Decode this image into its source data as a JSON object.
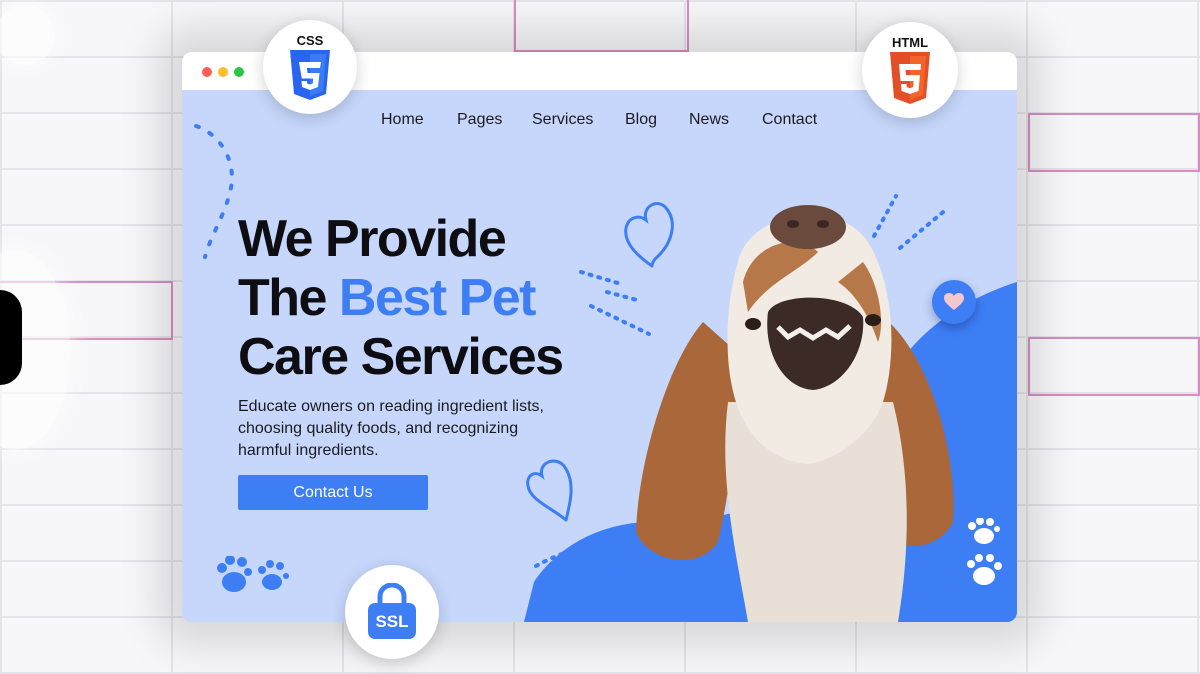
{
  "window": {
    "dots": [
      "#ff5f57",
      "#febc2e",
      "#28c840"
    ]
  },
  "nav": {
    "items": [
      {
        "id": "home",
        "label": "Home"
      },
      {
        "id": "pages",
        "label": "Pages"
      },
      {
        "id": "services",
        "label": "Services"
      },
      {
        "id": "blog",
        "label": "Blog"
      },
      {
        "id": "news",
        "label": "News"
      },
      {
        "id": "contact",
        "label": "Contact"
      }
    ]
  },
  "hero": {
    "line1": "We Provide",
    "line2_prefix": "The ",
    "line2_accent": "Best Pet",
    "line3": "Care Services",
    "description": "Educate owners on reading ingredient lists, choosing quality foods, and recognizing harmful ingredients.",
    "cta_label": "Contact Us"
  },
  "badges": {
    "css": {
      "label": "CSS",
      "icon": "css3-shield-icon",
      "color": "#2965f1"
    },
    "html": {
      "label": "HTML",
      "icon": "html5-shield-icon",
      "color": "#e34f26"
    },
    "ssl": {
      "label": "SSL",
      "icon": "ssl-lock-icon",
      "color": "#3d7ef5"
    }
  },
  "colors": {
    "accent": "#3d7ef5",
    "page_bg": "#c6d7fb",
    "text": "#0d0d12"
  }
}
